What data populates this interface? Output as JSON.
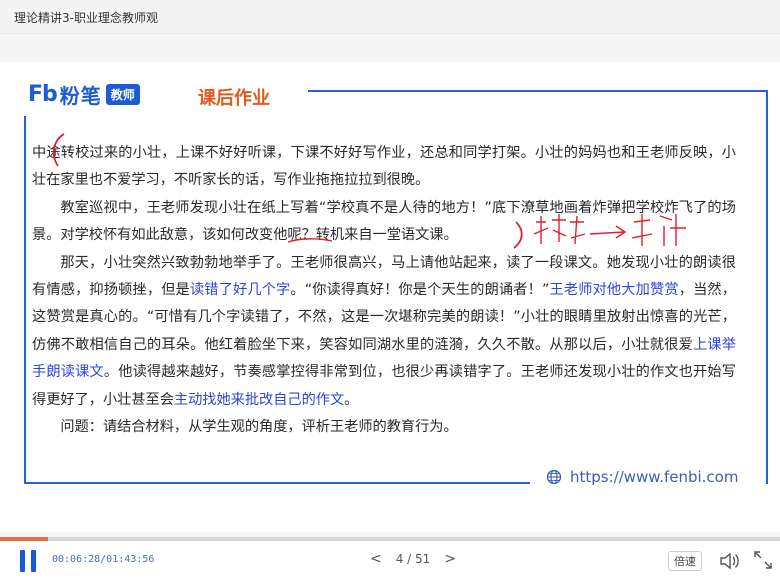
{
  "window": {
    "title": "理论精讲3-职业理念教师观"
  },
  "slide": {
    "logo": {
      "fb": "Fb",
      "brand": "粉笔",
      "badge": "教师"
    },
    "section_title": "课后作业",
    "website": "https://www.fenbi.com",
    "paragraphs": [
      {
        "segments": [
          {
            "t": "中途转校过来的小壮，上课不好好听课，下课不好好写作业，还总和同学打架。小壮的妈妈也和王老师反映，小壮在家里也不爱学习，不听家长的话，写作业拖拖拉拉到很晚。"
          }
        ]
      },
      {
        "segments": [
          {
            "t": "教室巡视中，王老师发现小壮在纸上写着“学校真不是人待的地方！”底下潦草地画着炸弹把学校炸飞了的场景。对学校怀有如此敌意，该如何改变他呢？转机来自一堂语文课。"
          }
        ]
      },
      {
        "segments": [
          {
            "t": "那天，小壮突然兴致勃勃地举手了。王老师很高兴，马上请他站起来，读了一段课文。她发现小壮的朗读很有情感，抑扬顿挫，但是"
          },
          {
            "t": "读错了好几个字",
            "hl": true
          },
          {
            "t": "。“你读得真好！你是个天生的朗诵者！”"
          },
          {
            "t": "王老师对他大加赞赏",
            "hl": true
          },
          {
            "t": "，当然，这赞赏是真心的。“可惜有几个字读错了，不然，这是一次堪称完美的朗读！”小壮的眼睛里放射出惊喜的光芒，仿佛不敢相信自己的耳朵。他红着脸坐下来，笑容如同湖水里的涟漪，久久不散。从那以后，小壮就很爱"
          },
          {
            "t": "上课举手朗读课文",
            "hl": true
          },
          {
            "t": "。他读得越来越好，节奏感掌控得非常到位，也很少再读错字了。王老师还发现小壮的作文也开始写得更好了，小壮甚至会"
          },
          {
            "t": "主动找她来批改自己的作文",
            "hl": true
          },
          {
            "t": "。"
          }
        ]
      },
      {
        "segments": [
          {
            "t": "问题：请结合材料，从学生观的角度，评析王老师的教育行为。"
          }
        ]
      }
    ]
  },
  "player": {
    "time": "00:06:28/01:43:56",
    "progress": 0.062,
    "page": "4 / 51",
    "prev": "<",
    "next": ">",
    "speed_label": "倍速"
  },
  "colors": {
    "accent": "#1a58d8",
    "title": "#e15b1f",
    "highlight": "#2b45e0",
    "ink": "#e0202a"
  },
  "icons": [
    "pause-icon",
    "prev-page-icon",
    "next-page-icon",
    "volume-icon",
    "fullscreen-icon",
    "globe-icon"
  ]
}
